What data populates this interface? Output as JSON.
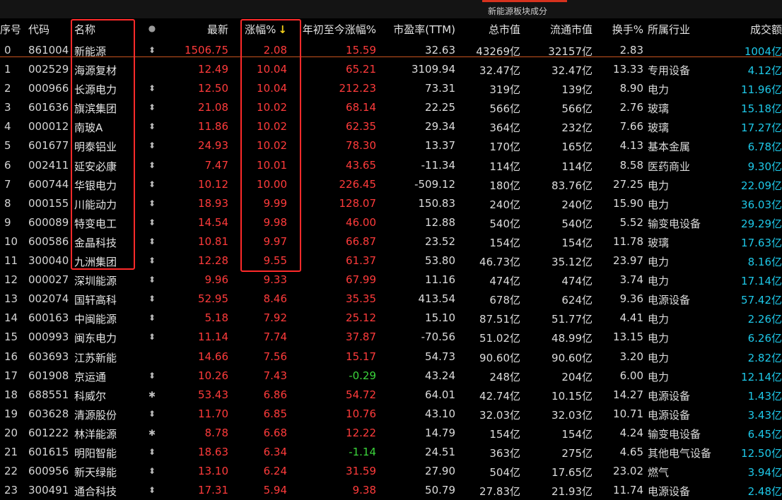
{
  "panel_title": "新能源板块成分",
  "columns": {
    "seq": "序号",
    "code": "代码",
    "name": "名称",
    "flag": "●",
    "last": "最新",
    "chg": "涨幅%",
    "sort_arrow": "↓",
    "ytd": "年初至今涨幅%",
    "pe": "市盈率(TTM)",
    "mcap": "总市值",
    "fcap": "流通市值",
    "turn": "换手%",
    "ind": "所属行业",
    "vol": "成交额"
  },
  "colors": {
    "up": "#ff3b3b",
    "down": "#3bd43b",
    "volume": "#1ec8e8",
    "highlight": "#ff2a2a"
  },
  "rows": [
    {
      "seq": "0",
      "code": "861004",
      "name": "新能源",
      "flag": "⬍",
      "last": "1506.75",
      "chg": "2.08",
      "ytd": "15.59",
      "pe": "32.63",
      "mcap": "43269亿",
      "fcap": "32157亿",
      "turn": "2.83",
      "ind": "",
      "vol": "1004亿"
    },
    {
      "seq": "1",
      "code": "002529",
      "name": "海源复材",
      "flag": "",
      "last": "12.49",
      "chg": "10.04",
      "ytd": "65.21",
      "pe": "3109.94",
      "mcap": "32.47亿",
      "fcap": "32.47亿",
      "turn": "13.33",
      "ind": "专用设备",
      "vol": "4.12亿"
    },
    {
      "seq": "2",
      "code": "000966",
      "name": "长源电力",
      "flag": "⬍",
      "last": "12.50",
      "chg": "10.04",
      "ytd": "212.23",
      "pe": "73.31",
      "mcap": "319亿",
      "fcap": "139亿",
      "turn": "8.90",
      "ind": "电力",
      "vol": "11.96亿"
    },
    {
      "seq": "3",
      "code": "601636",
      "name": "旗滨集团",
      "flag": "⬍",
      "last": "21.08",
      "chg": "10.02",
      "ytd": "68.14",
      "pe": "22.25",
      "mcap": "566亿",
      "fcap": "566亿",
      "turn": "2.76",
      "ind": "玻璃",
      "vol": "15.18亿"
    },
    {
      "seq": "4",
      "code": "000012",
      "name": "南玻A",
      "flag": "⬍",
      "last": "11.86",
      "chg": "10.02",
      "ytd": "62.35",
      "pe": "29.34",
      "mcap": "364亿",
      "fcap": "232亿",
      "turn": "7.66",
      "ind": "玻璃",
      "vol": "17.27亿"
    },
    {
      "seq": "5",
      "code": "601677",
      "name": "明泰铝业",
      "flag": "⬍",
      "last": "24.93",
      "chg": "10.02",
      "ytd": "78.30",
      "pe": "13.37",
      "mcap": "170亿",
      "fcap": "165亿",
      "turn": "4.13",
      "ind": "基本金属",
      "vol": "6.78亿"
    },
    {
      "seq": "6",
      "code": "002411",
      "name": "延安必康",
      "flag": "⬍",
      "last": "7.47",
      "chg": "10.01",
      "ytd": "43.65",
      "pe": "-11.34",
      "mcap": "114亿",
      "fcap": "114亿",
      "turn": "8.58",
      "ind": "医药商业",
      "vol": "9.30亿"
    },
    {
      "seq": "7",
      "code": "600744",
      "name": "华银电力",
      "flag": "⬍",
      "last": "10.12",
      "chg": "10.00",
      "ytd": "226.45",
      "pe": "-509.12",
      "mcap": "180亿",
      "fcap": "83.76亿",
      "turn": "27.25",
      "ind": "电力",
      "vol": "22.09亿"
    },
    {
      "seq": "8",
      "code": "000155",
      "name": "川能动力",
      "flag": "⬍",
      "last": "18.93",
      "chg": "9.99",
      "ytd": "128.07",
      "pe": "150.83",
      "mcap": "240亿",
      "fcap": "240亿",
      "turn": "15.90",
      "ind": "电力",
      "vol": "36.03亿"
    },
    {
      "seq": "9",
      "code": "600089",
      "name": "特变电工",
      "flag": "⬍",
      "last": "14.54",
      "chg": "9.98",
      "ytd": "46.00",
      "pe": "12.88",
      "mcap": "540亿",
      "fcap": "540亿",
      "turn": "5.52",
      "ind": "输变电设备",
      "vol": "29.29亿"
    },
    {
      "seq": "10",
      "code": "600586",
      "name": "金晶科技",
      "flag": "⬍",
      "last": "10.81",
      "chg": "9.97",
      "ytd": "66.87",
      "pe": "23.52",
      "mcap": "154亿",
      "fcap": "154亿",
      "turn": "11.78",
      "ind": "玻璃",
      "vol": "17.63亿"
    },
    {
      "seq": "11",
      "code": "300040",
      "name": "九洲集团",
      "flag": "⬍",
      "last": "12.28",
      "chg": "9.55",
      "ytd": "61.37",
      "pe": "53.80",
      "mcap": "46.73亿",
      "fcap": "35.12亿",
      "turn": "23.97",
      "ind": "电力",
      "vol": "8.16亿"
    },
    {
      "seq": "12",
      "code": "000027",
      "name": "深圳能源",
      "flag": "⬍",
      "last": "9.96",
      "chg": "9.33",
      "ytd": "67.99",
      "pe": "11.16",
      "mcap": "474亿",
      "fcap": "474亿",
      "turn": "3.74",
      "ind": "电力",
      "vol": "17.14亿"
    },
    {
      "seq": "13",
      "code": "002074",
      "name": "国轩高科",
      "flag": "⬍",
      "last": "52.95",
      "chg": "8.46",
      "ytd": "35.35",
      "pe": "413.54",
      "mcap": "678亿",
      "fcap": "624亿",
      "turn": "9.36",
      "ind": "电源设备",
      "vol": "57.42亿"
    },
    {
      "seq": "14",
      "code": "600163",
      "name": "中闽能源",
      "flag": "⬍",
      "last": "5.18",
      "chg": "7.92",
      "ytd": "25.12",
      "pe": "15.10",
      "mcap": "87.51亿",
      "fcap": "51.77亿",
      "turn": "4.41",
      "ind": "电力",
      "vol": "2.26亿"
    },
    {
      "seq": "15",
      "code": "000993",
      "name": "闽东电力",
      "flag": "⬍",
      "last": "11.14",
      "chg": "7.74",
      "ytd": "37.87",
      "pe": "-70.56",
      "mcap": "51.02亿",
      "fcap": "48.99亿",
      "turn": "13.15",
      "ind": "电力",
      "vol": "6.26亿"
    },
    {
      "seq": "16",
      "code": "603693",
      "name": "江苏新能",
      "flag": "",
      "last": "14.66",
      "chg": "7.56",
      "ytd": "15.17",
      "pe": "54.73",
      "mcap": "90.60亿",
      "fcap": "90.60亿",
      "turn": "3.20",
      "ind": "电力",
      "vol": "2.82亿"
    },
    {
      "seq": "17",
      "code": "601908",
      "name": "京运通",
      "flag": "⬍",
      "last": "10.26",
      "chg": "7.43",
      "ytd": "-0.29",
      "pe": "43.24",
      "mcap": "248亿",
      "fcap": "204亿",
      "turn": "6.00",
      "ind": "电力",
      "vol": "12.14亿"
    },
    {
      "seq": "18",
      "code": "688551",
      "name": "科威尔",
      "flag": "✱",
      "last": "53.43",
      "chg": "6.86",
      "ytd": "54.72",
      "pe": "64.01",
      "mcap": "42.74亿",
      "fcap": "10.15亿",
      "turn": "14.27",
      "ind": "电源设备",
      "vol": "1.43亿"
    },
    {
      "seq": "19",
      "code": "603628",
      "name": "清源股份",
      "flag": "⬍",
      "last": "11.70",
      "chg": "6.85",
      "ytd": "10.76",
      "pe": "43.10",
      "mcap": "32.03亿",
      "fcap": "32.03亿",
      "turn": "10.71",
      "ind": "电源设备",
      "vol": "3.43亿"
    },
    {
      "seq": "20",
      "code": "601222",
      "name": "林洋能源",
      "flag": "✱",
      "last": "8.78",
      "chg": "6.68",
      "ytd": "12.22",
      "pe": "14.79",
      "mcap": "154亿",
      "fcap": "154亿",
      "turn": "4.24",
      "ind": "输变电设备",
      "vol": "6.45亿"
    },
    {
      "seq": "21",
      "code": "601615",
      "name": "明阳智能",
      "flag": "⬍",
      "last": "18.63",
      "chg": "6.34",
      "ytd": "-1.14",
      "pe": "24.51",
      "mcap": "363亿",
      "fcap": "275亿",
      "turn": "4.65",
      "ind": "其他电气设备",
      "vol": "12.50亿"
    },
    {
      "seq": "22",
      "code": "600956",
      "name": "新天绿能",
      "flag": "⬍",
      "last": "13.10",
      "chg": "6.24",
      "ytd": "31.59",
      "pe": "27.90",
      "mcap": "504亿",
      "fcap": "17.65亿",
      "turn": "23.02",
      "ind": "燃气",
      "vol": "3.94亿"
    },
    {
      "seq": "23",
      "code": "300491",
      "name": "通合科技",
      "flag": "⬍",
      "last": "17.31",
      "chg": "5.94",
      "ytd": "9.38",
      "pe": "50.79",
      "mcap": "27.83亿",
      "fcap": "21.93亿",
      "turn": "11.74",
      "ind": "电源设备",
      "vol": "2.48亿"
    }
  ]
}
